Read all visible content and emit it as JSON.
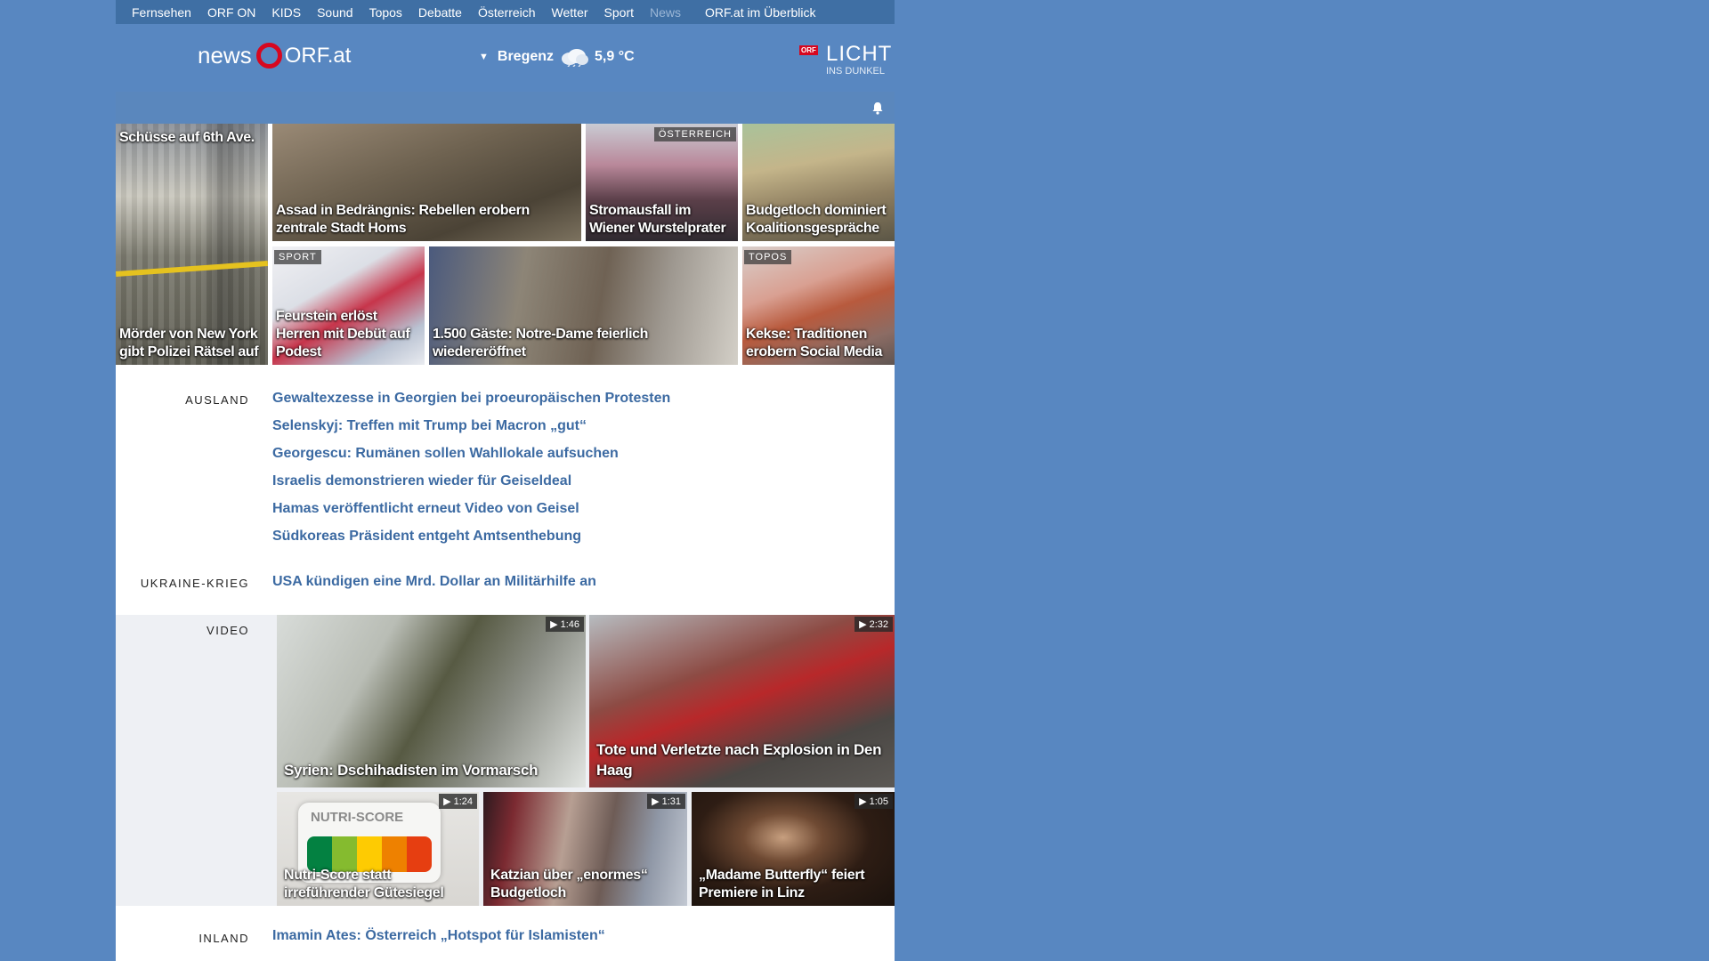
{
  "topnav": {
    "items": [
      "Fernsehen",
      "ORF ON",
      "KIDS",
      "Sound",
      "Topos",
      "Debatte",
      "Österreich",
      "Wetter",
      "Sport",
      "News"
    ],
    "active": "News",
    "overview": "ORF.at im Überblick"
  },
  "header": {
    "logo_news": "news",
    "logo_orf": "ORF.at",
    "weather_city": "Bregenz",
    "weather_temp": "5,9 °C",
    "weather_icon": "cloud-rain-icon",
    "lid_badge": "ORF",
    "lid_title": "LICHT",
    "lid_sub": "INS DUNKEL"
  },
  "teasers": {
    "newyork": {
      "title": "Mörder von New York gibt Polizei Rätsel auf",
      "overlay": "Schüsse auf 6th Ave."
    },
    "assad": {
      "title": "Assad in Bedrängnis: Rebellen erobern zentrale Stadt Homs"
    },
    "wurstelprater": {
      "title": "Stromausfall im Wiener Wurstelprater",
      "tag": "ÖSTERREICH"
    },
    "budget": {
      "title": "Budgetloch dominiert Koalitionsgespräche"
    },
    "feurstein": {
      "title": "Feurstein erlöst Herren mit Debüt auf Podest",
      "tag": "SPORT"
    },
    "notredame": {
      "title": "1.500 Gäste: Notre-Dame feierlich wiedereröffnet"
    },
    "kekse": {
      "title": "Kekse: Traditionen erobern Social Media",
      "tag": "TOPOS"
    }
  },
  "sections": {
    "ausland": {
      "label": "AUSLAND",
      "stories": [
        "Gewaltexzesse in Georgien bei proeuropäischen Protesten",
        "Selenskyj: Treffen mit Trump bei Macron „gut“",
        "Georgescu: Rumänen sollen Wahllokale aufsuchen",
        "Israelis demonstrieren wieder für Geiseldeal",
        "Hamas veröffentlicht erneut Video von Geisel",
        "Südkoreas Präsident entgeht Amtsenthebung"
      ]
    },
    "ukraine": {
      "label": "UKRAINE-KRIEG",
      "stories": [
        "USA kündigen eine Mrd. Dollar an Militärhilfe an"
      ]
    },
    "video": {
      "label": "VIDEO",
      "items": [
        {
          "title": "Syrien: Dschihadisten im Vormarsch",
          "duration": "1:46"
        },
        {
          "title": "Tote und Verletzte nach Explosion in Den Haag",
          "duration": "2:32"
        },
        {
          "title": "Nutri-Score statt irreführender Gütesiegel",
          "duration": "1:24",
          "image_text": "NUTRI-SCORE"
        },
        {
          "title": "Katzian über „enormes“ Budgetloch",
          "duration": "1:31"
        },
        {
          "title": "„Madame Butterfly“ feiert Premiere in Linz",
          "duration": "1:05"
        }
      ]
    },
    "inland": {
      "label": "INLAND",
      "stories": [
        "Imamin Ates: Österreich „Hotspot für Islamisten“"
      ]
    }
  },
  "colors": {
    "background": "#5887c1",
    "topnav": "#3f6fa4",
    "link": "#3c6aa2",
    "orf_red": "#d7071f"
  }
}
